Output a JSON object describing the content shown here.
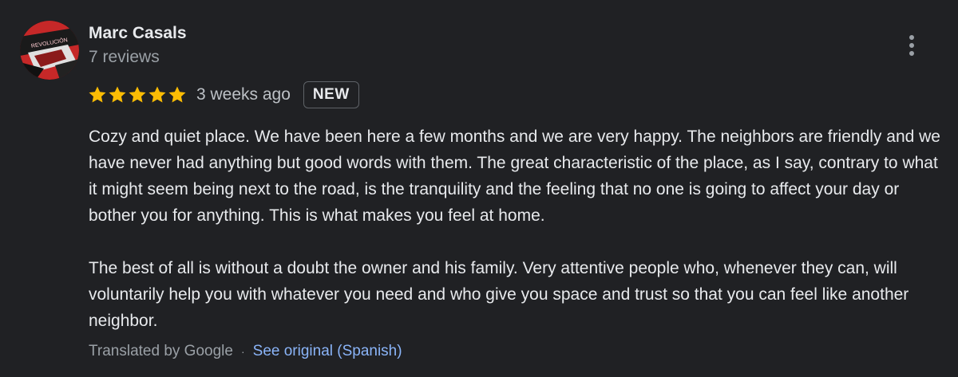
{
  "review": {
    "author_name": "Marc Casals",
    "reviews_count": "7 reviews",
    "rating": 5,
    "rating_max": 5,
    "time_ago": "3 weeks ago",
    "badge": "NEW",
    "paragraphs": [
      "Cozy and quiet place. We have been here a few months and we are very happy. The neighbors are friendly and we have never had anything but good words with them. The great characteristic of the place, as I say, contrary to what it might seem being next to the road, is the tranquility and the feeling that no one is going to affect your day or bother you for anything. This is what makes you feel at home.",
      "The best of all is without a doubt the owner and his family. Very attentive people who, whenever they can, will voluntarily help you with whatever you need and who give you space and trust so that you can feel like another neighbor."
    ],
    "translated_label": "Translated by Google",
    "separator": "·",
    "see_original_label": "See original (Spanish)"
  },
  "icons": {
    "menu": "more-vertical-icon",
    "star": "star-icon"
  },
  "colors": {
    "background": "#202124",
    "star": "#fbbc04",
    "link": "#8ab4f8",
    "secondary_text": "#9aa0a6"
  }
}
